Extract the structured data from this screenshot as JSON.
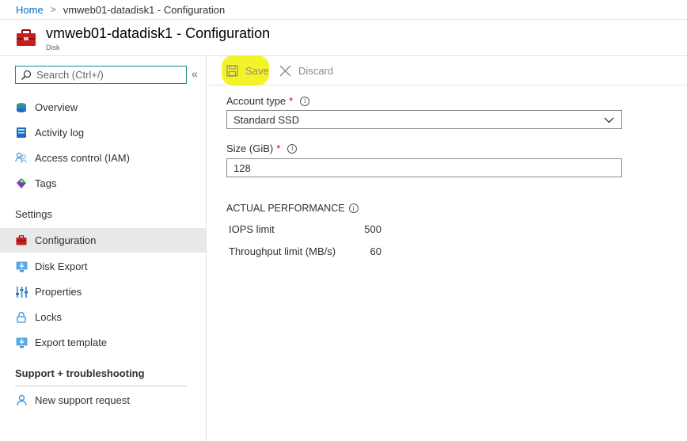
{
  "breadcrumb": {
    "home": "Home",
    "separator": ">",
    "current": "vmweb01-datadisk1 - Configuration"
  },
  "header": {
    "title": "vmweb01-datadisk1 - Configuration",
    "subtitle": "Disk",
    "icon": "toolbox-icon",
    "icon_color": "#c41e1e"
  },
  "sidebar": {
    "search_placeholder": "Search (Ctrl+/)",
    "collapse_glyph": "«",
    "items": [
      {
        "label": "Overview",
        "icon": "overview-icon"
      },
      {
        "label": "Activity log",
        "icon": "activity-log-icon"
      },
      {
        "label": "Access control (IAM)",
        "icon": "people-icon"
      },
      {
        "label": "Tags",
        "icon": "tag-icon"
      }
    ],
    "settings_heading": "Settings",
    "settings_items": [
      {
        "label": "Configuration",
        "icon": "toolbox-icon",
        "active": true
      },
      {
        "label": "Disk Export",
        "icon": "export-icon"
      },
      {
        "label": "Properties",
        "icon": "properties-icon"
      },
      {
        "label": "Locks",
        "icon": "lock-icon"
      },
      {
        "label": "Export template",
        "icon": "template-icon"
      }
    ],
    "support_heading": "Support + troubleshooting",
    "support_items": [
      {
        "label": "New support request",
        "icon": "support-icon"
      }
    ]
  },
  "toolbar": {
    "save_label": "Save",
    "discard_label": "Discard",
    "save_highlight_color": "#f2f21f"
  },
  "form": {
    "account_type_label": "Account type",
    "account_type_value": "Standard SSD",
    "size_label": "Size (GiB)",
    "size_value": "128",
    "required_mark": "*",
    "info_glyph": "i"
  },
  "performance": {
    "title": "ACTUAL PERFORMANCE",
    "rows": [
      {
        "label": "IOPS limit",
        "value": "500"
      },
      {
        "label": "Throughput limit (MB/s)",
        "value": "60"
      }
    ]
  }
}
